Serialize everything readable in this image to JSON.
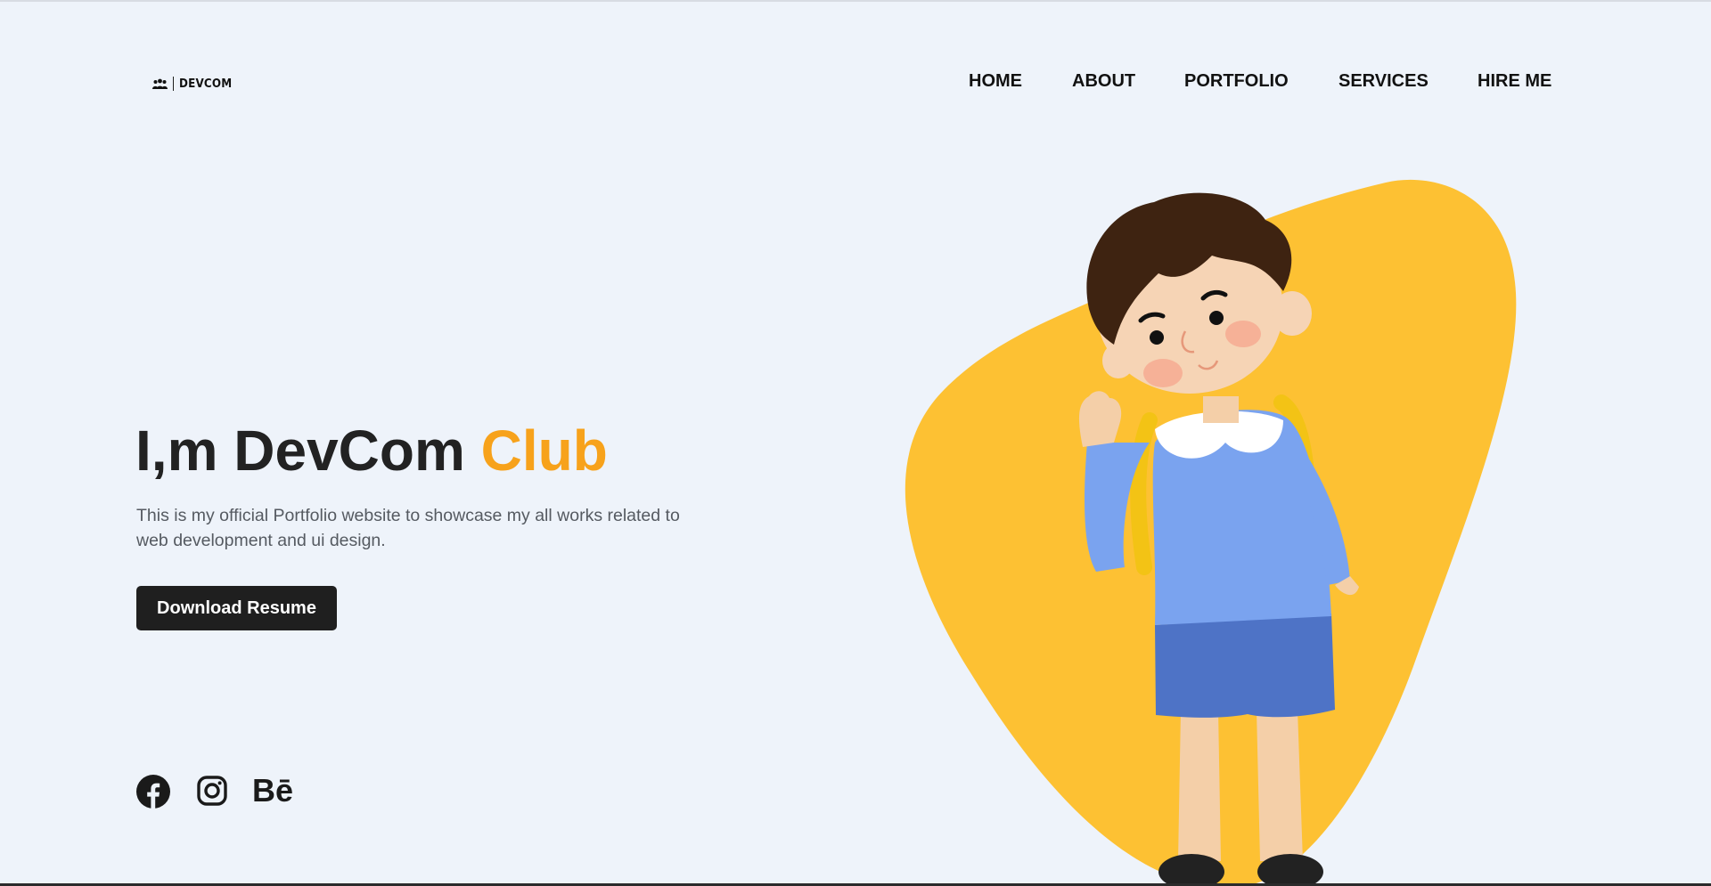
{
  "header": {
    "logo_text": "DEVCOM",
    "logo_icon": "users-icon",
    "nav": {
      "home": "HOME",
      "about": "ABOUT",
      "portfolio": "PORTFOLIO",
      "services": "SERVICES",
      "hire_me": "HIRE ME"
    }
  },
  "hero": {
    "title_main": "I,m DevCom ",
    "title_accent": "Club",
    "description": "This is my official Portfolio website to showcase my all works related to web development and ui design.",
    "download_button": "Download Resume"
  },
  "social": {
    "facebook_icon": "facebook-icon",
    "instagram_icon": "instagram-icon",
    "behance_label": "Bē"
  },
  "colors": {
    "background": "#eef3fa",
    "accent": "#f7a21b",
    "blob": "#fdc133",
    "text_dark": "#222222",
    "button_bg": "#1f1f1f"
  }
}
